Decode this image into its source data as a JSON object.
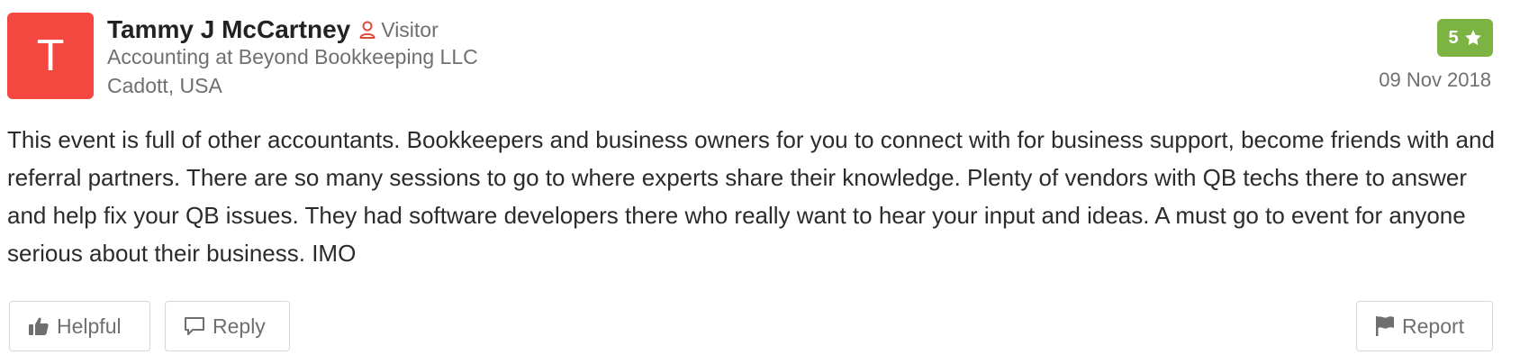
{
  "reviewer": {
    "initial": "T",
    "name": "Tammy J McCartney",
    "role": "Visitor",
    "company": "Accounting at Beyond Bookkeeping LLC",
    "location": "Cadott, USA"
  },
  "rating": {
    "value": "5",
    "icon": "star-icon",
    "color": "#7cb342"
  },
  "date": "09 Nov 2018",
  "review_text": "This event is full of other accountants. Bookkeepers and business owners for you to connect with for business support, become friends with and referral partners. There are so many sessions to go to where experts share their knowledge. Plenty of vendors with QB techs there to answer and help fix your QB issues. They had software developers there who really want to hear your input and ideas. A must go to event for anyone serious about their business. IMO",
  "actions": {
    "helpful": {
      "label": "Helpful",
      "icon": "thumbs-up-icon"
    },
    "reply": {
      "label": "Reply",
      "icon": "comment-icon"
    },
    "report": {
      "label": "Report",
      "icon": "flag-icon"
    }
  },
  "colors": {
    "avatar_bg": "#f4473f",
    "role_icon": "#e0483e"
  }
}
